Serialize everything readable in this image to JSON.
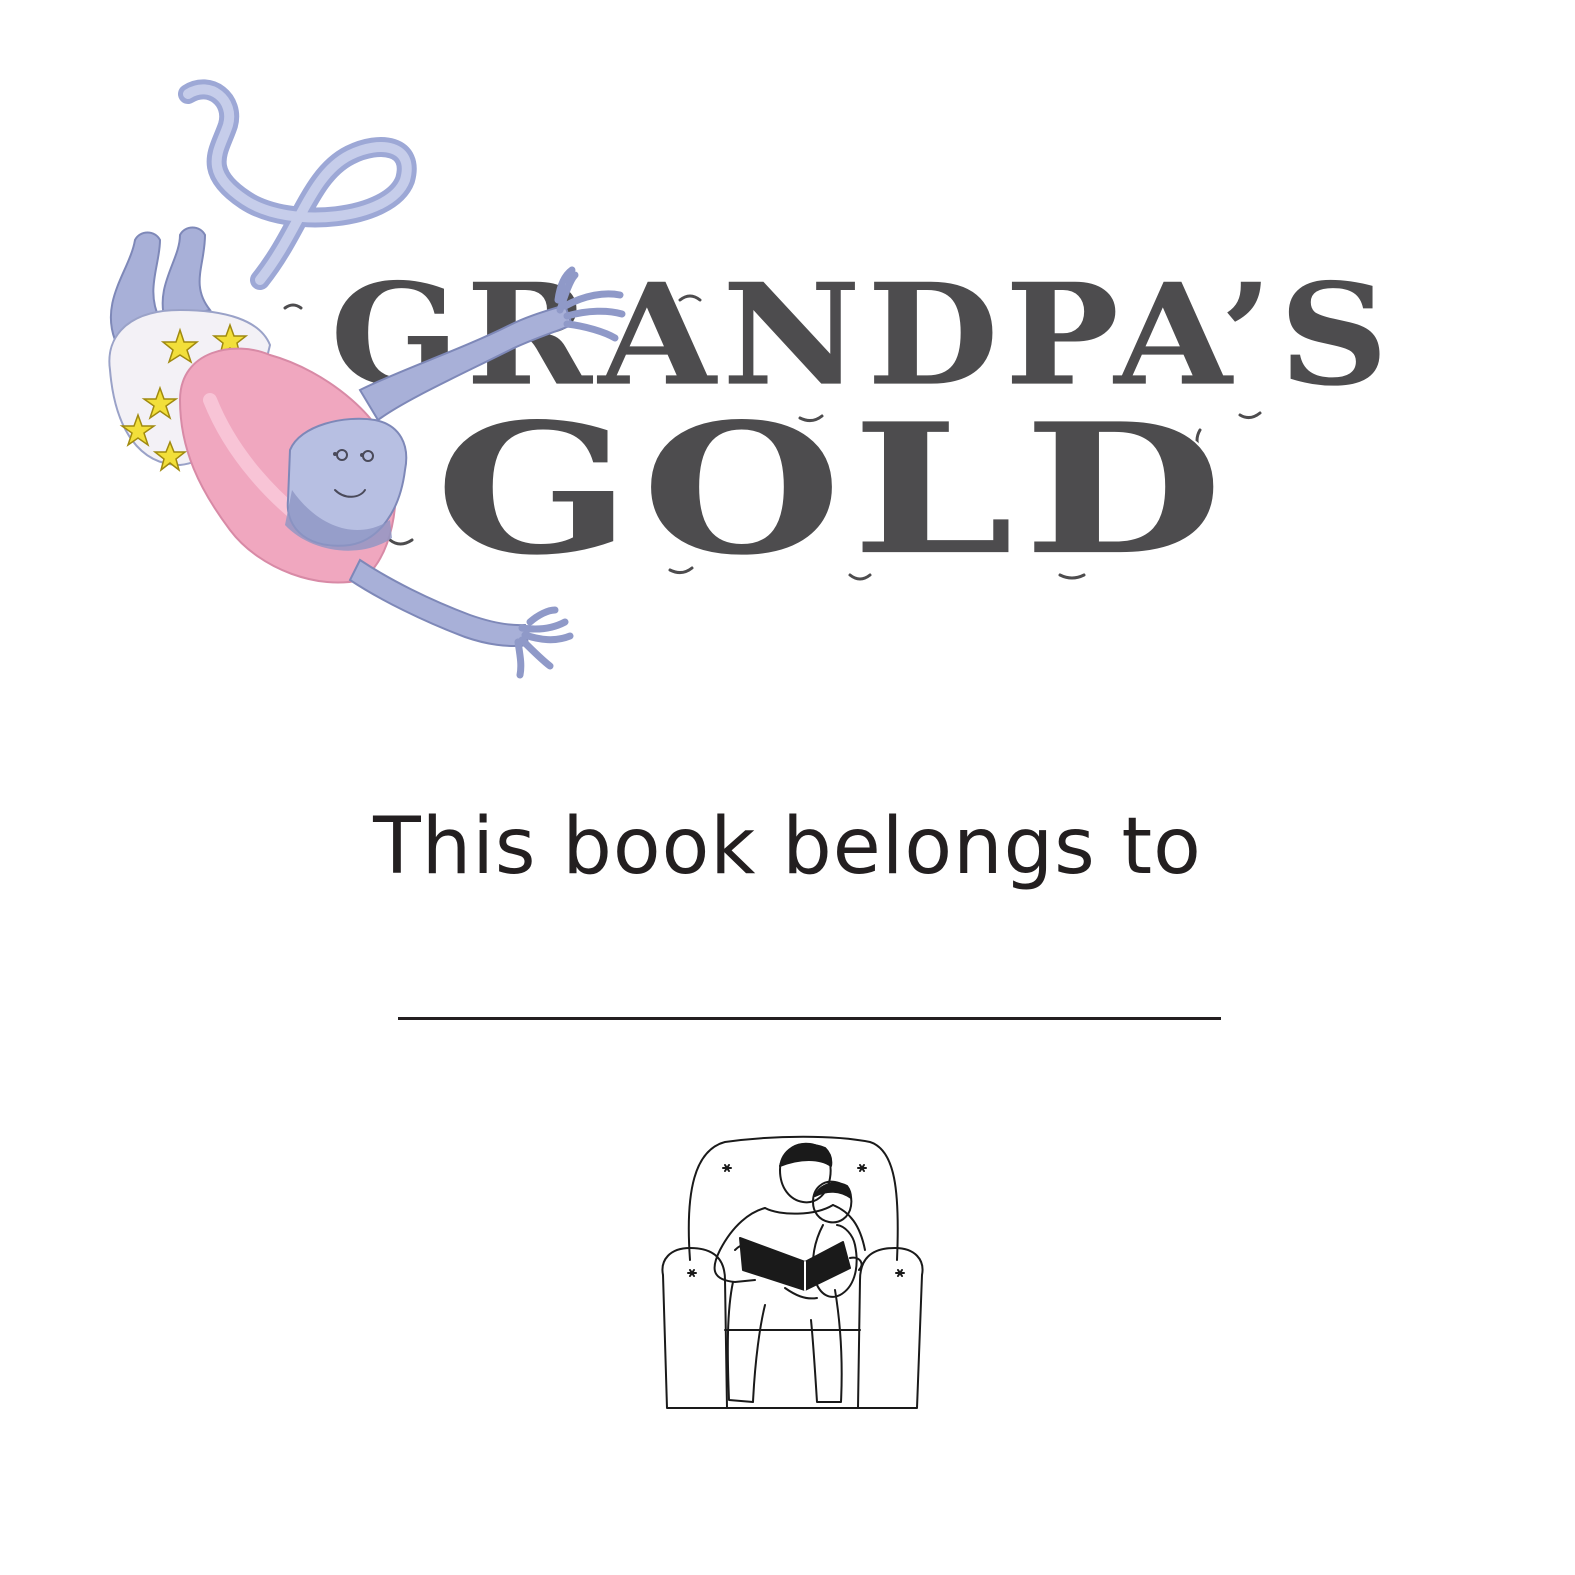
{
  "cover": {
    "title_line_1": "GRANDPA’S",
    "title_line_2": "GOLD"
  },
  "ownership": {
    "label": "This book belongs to",
    "name_value": ""
  },
  "icons": {
    "character": "flying-ghost-character-illustration",
    "reading": "parent-reading-to-child-icon"
  },
  "colors": {
    "title": "#4d4c4e",
    "text": "#231f20",
    "ghost": "#a9b4dc",
    "shirt": "#f0a7bf",
    "stars": "#f2df3a"
  }
}
